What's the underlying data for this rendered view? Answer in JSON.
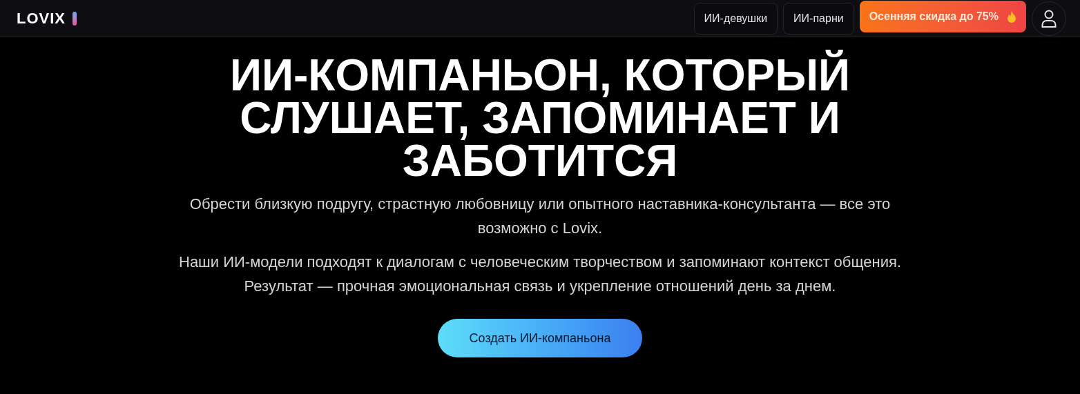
{
  "header": {
    "logo": "LOVIX",
    "nav": [
      {
        "label": "ИИ-девушки",
        "kind": "link"
      },
      {
        "label": "ИИ-парни",
        "kind": "link"
      },
      {
        "label": "Осенняя скидка до 75%",
        "kind": "promo"
      }
    ]
  },
  "hero": {
    "headline_lines": [
      "ИИ-КОМПАНЬОН, КОТОРЫЙ",
      "СЛУШАЕТ, ЗАПОМИНАЕТ И",
      "ЗАБОТИТСЯ"
    ],
    "paragraphs": [
      "Обрести близкую подругу, страстную любовницу или опытного наставника-консультанта — все это возможно с Lovix.",
      "Наши ИИ-модели подходят к диалогам с человеческим творчеством и запоминают контекст общения. Результат — прочная эмоциональная связь и укрепление отношений день за днем."
    ],
    "cta": "Создать ИИ-компаньона"
  }
}
